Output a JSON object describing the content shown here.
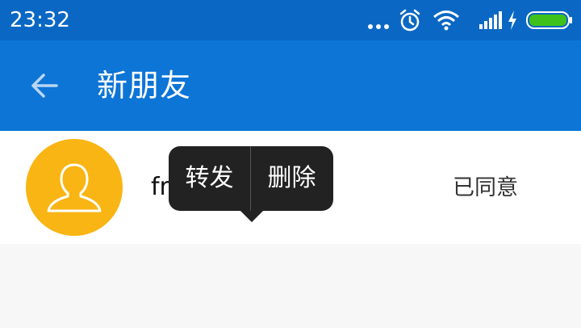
{
  "status_bar": {
    "time": "23:32",
    "icons": [
      "more-dots-icon",
      "alarm-clock-icon",
      "wifi-icon",
      "cell-signal-icon",
      "charging-bolt-icon",
      "battery-icon"
    ],
    "battery_color": "#3ec21b"
  },
  "app_bar": {
    "title": "新朋友",
    "back_icon": "arrow-left-icon",
    "background": "#0d75d6"
  },
  "friends": [
    {
      "avatar_icon": "person-silhouette-icon",
      "avatar_color": "#f9b513",
      "name_visible": "fr",
      "status": "已同意"
    }
  ],
  "context_menu": {
    "items": [
      {
        "label": "转发"
      },
      {
        "label": "删除"
      }
    ]
  }
}
